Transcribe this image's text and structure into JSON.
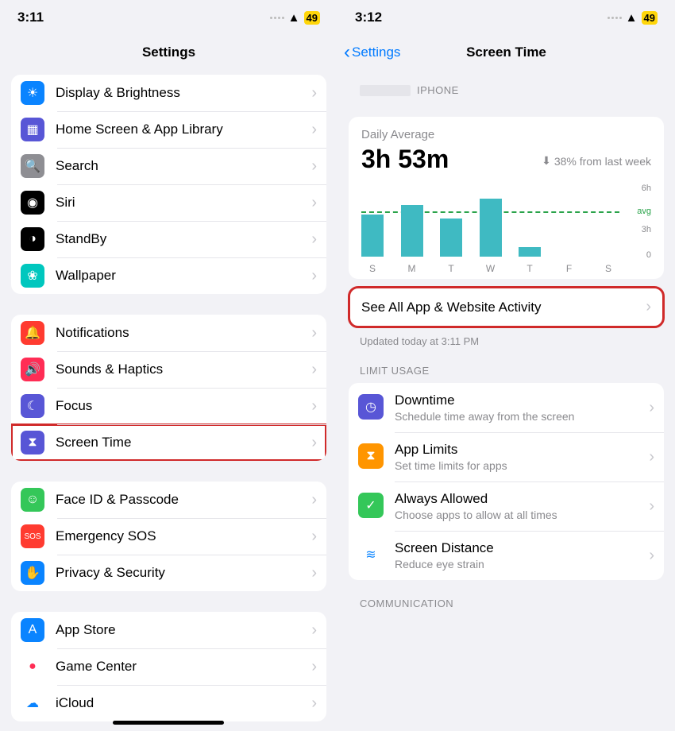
{
  "left": {
    "status": {
      "time": "3:11",
      "battery": "49"
    },
    "title": "Settings",
    "groups": [
      [
        {
          "label": "Display & Brightness",
          "icon": "☀",
          "bg": "#0a84ff"
        },
        {
          "label": "Home Screen & App Library",
          "icon": "▦",
          "bg": "#5856d6"
        },
        {
          "label": "Search",
          "icon": "🔍",
          "bg": "#8e8e93"
        },
        {
          "label": "Siri",
          "icon": "◉",
          "bg": "#000"
        },
        {
          "label": "StandBy",
          "icon": "◑",
          "bg": "#000"
        },
        {
          "label": "Wallpaper",
          "icon": "❀",
          "bg": "#00c7be"
        }
      ],
      [
        {
          "label": "Notifications",
          "icon": "🔔",
          "bg": "#ff3b30"
        },
        {
          "label": "Sounds & Haptics",
          "icon": "🔊",
          "bg": "#ff2d55"
        },
        {
          "label": "Focus",
          "icon": "☾",
          "bg": "#5856d6"
        },
        {
          "label": "Screen Time",
          "icon": "⧗",
          "bg": "#5856d6",
          "hl": true
        }
      ],
      [
        {
          "label": "Face ID & Passcode",
          "icon": "☺",
          "bg": "#34c759"
        },
        {
          "label": "Emergency SOS",
          "icon": "SOS",
          "bg": "#ff3b30",
          "fs": "10"
        },
        {
          "label": "Privacy & Security",
          "icon": "✋",
          "bg": "#0a84ff"
        }
      ],
      [
        {
          "label": "App Store",
          "icon": "A",
          "bg": "#0a84ff"
        },
        {
          "label": "Game Center",
          "icon": "●",
          "bg": "#fff",
          "fg": "#ff2d55"
        },
        {
          "label": "iCloud",
          "icon": "☁",
          "bg": "#fff",
          "fg": "#0a84ff"
        }
      ]
    ]
  },
  "right": {
    "status": {
      "time": "3:12",
      "battery": "49"
    },
    "back": "Settings",
    "title": "Screen Time",
    "device": "IPHONE",
    "daily_label": "Daily Average",
    "daily_value": "3h 53m",
    "trend": "38% from last week",
    "see_all": "See All App & Website Activity",
    "updated": "Updated today at 3:11 PM",
    "limit_header": "LIMIT USAGE",
    "limits": [
      {
        "title": "Downtime",
        "sub": "Schedule time away from the screen",
        "icon": "◷",
        "bg": "#5856d6"
      },
      {
        "title": "App Limits",
        "sub": "Set time limits for apps",
        "icon": "⧗",
        "bg": "#ff9500"
      },
      {
        "title": "Always Allowed",
        "sub": "Choose apps to allow at all times",
        "icon": "✓",
        "bg": "#34c759"
      },
      {
        "title": "Screen Distance",
        "sub": "Reduce eye strain",
        "icon": "≋",
        "bg": "#fff",
        "fg": "#0a84ff"
      }
    ],
    "comm_header": "COMMUNICATION",
    "ylabels": {
      "top": "6h",
      "avg": "avg",
      "mid": "3h",
      "bot": "0"
    }
  },
  "chart_data": {
    "type": "bar",
    "categories": [
      "S",
      "M",
      "T",
      "W",
      "T",
      "F",
      "S"
    ],
    "values": [
      3.6,
      4.4,
      3.3,
      5.0,
      0.8,
      0,
      0
    ],
    "title": "Daily Average 3h 53m",
    "ylabel": "hours",
    "ylim": [
      0,
      6
    ],
    "avg": 3.88
  }
}
